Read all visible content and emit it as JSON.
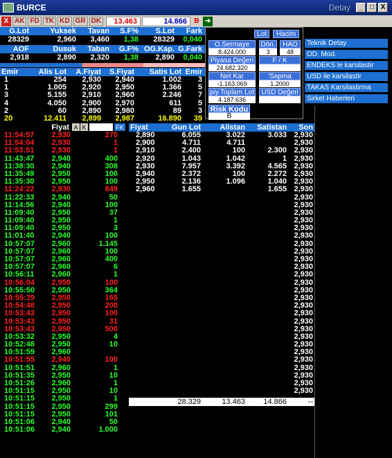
{
  "window": {
    "title": "BURCE",
    "title_right": "Detay",
    "btn_min": "_",
    "btn_max": "□",
    "btn_close": "X"
  },
  "toolbar": {
    "close": "X",
    "buttons": [
      "AK",
      "FD",
      "TK",
      "KD",
      "GR",
      "DK"
    ],
    "value1": "13.463",
    "value2": "14.866",
    "b": "B"
  },
  "summary": {
    "row1_headers": [
      "G.Lot",
      "Yuksek",
      "Tavan",
      "S.F%",
      "S.Lot",
      "Fark"
    ],
    "row1_values": [
      "28329",
      "2,960",
      "3,460",
      "1,38",
      "28329",
      "0,040"
    ],
    "row2_headers": [
      "AOF",
      "Dusuk",
      "Taban",
      "G.F%",
      "OG.Kap.",
      "G.Fark"
    ],
    "row2_values": [
      "2,918",
      "2,890",
      "2,320",
      "1,38",
      "2,890",
      "0,040"
    ]
  },
  "depth": {
    "headers": [
      "Emir",
      "Alis Lot",
      "A.Fiyat",
      "S.Fiyat",
      "Satis Lot",
      "Emir"
    ],
    "rows": [
      [
        "1",
        "254",
        "2,930",
        "2,940",
        "1.002",
        "3"
      ],
      [
        "1",
        "1.005",
        "2,920",
        "2,950",
        "1.366",
        "5"
      ],
      [
        "3",
        "5.155",
        "2,910",
        "2,960",
        "2.246",
        "7"
      ],
      [
        "4",
        "4.050",
        "2,900",
        "2,970",
        "611",
        "5"
      ],
      [
        "2",
        "60",
        "2,890",
        "2,980",
        "89",
        "3"
      ],
      [
        "20",
        "12.411",
        "2,899",
        "2,987",
        "16.890",
        "39"
      ]
    ]
  },
  "info": {
    "lot": "Lot",
    "hacim": "Hacim",
    "osermaye_label": "O.Sermaye",
    "osermaye": "8.424.000",
    "don_label": "Dön.",
    "don": "3",
    "hao_label": "HAO",
    "hao": "48",
    "piyasa_label": "Piyasa Değeri",
    "piyasa": "24.682.320",
    "fk_label": "F / K",
    "fk": "",
    "netkar_label": "Net Kar",
    "netkar": "-1.163.069",
    "sapma_label": "'Sapma",
    "sapma": "1.2000",
    "pytoplam_label": "piy.Toplam Lot",
    "pytoplam": "4.187.636",
    "usd_label": "USD Değeri",
    "usd": "",
    "risk_label": "Risk Kodu",
    "risk": "B"
  },
  "menu": [
    "Teknik Detay",
    "OD. Mod.",
    "ENDEKS le karsilastir",
    "USD ile karsilastir",
    "TAKAS Karsilastirma",
    "Sirket Haberleri"
  ],
  "trades_header": {
    "fiyat": "Fiyat",
    "a": "A",
    "k": "K",
    "fk": "FK"
  },
  "trades": [
    [
      "11:54:57",
      "2,930",
      "270",
      "r"
    ],
    [
      "11:54:04",
      "2,930",
      "1",
      "r"
    ],
    [
      "11:53:51",
      "2,930",
      "1",
      "r"
    ],
    [
      "11:43:47",
      "2,940",
      "400",
      "g"
    ],
    [
      "11:38:30",
      "2,940",
      "308",
      "g"
    ],
    [
      "11:35:49",
      "2,950",
      "100",
      "g"
    ],
    [
      "11:35:30",
      "2,950",
      "100",
      "g"
    ],
    [
      "11:24:22",
      "2,930",
      "849",
      "r"
    ],
    [
      "11:22:33",
      "2,940",
      "50",
      "g"
    ],
    [
      "11:14:56",
      "2,940",
      "100",
      "g"
    ],
    [
      "11:09:40",
      "2,950",
      "37",
      "g"
    ],
    [
      "11:09:40",
      "2,950",
      "1",
      "g"
    ],
    [
      "11:09:40",
      "2,950",
      "3",
      "g"
    ],
    [
      "11:01:40",
      "2,940",
      "100",
      "g"
    ],
    [
      "10:57:07",
      "2,960",
      "1.145",
      "g"
    ],
    [
      "10:57:07",
      "2,960",
      "100",
      "g"
    ],
    [
      "10:57:07",
      "2,960",
      "400",
      "g"
    ],
    [
      "10:57:07",
      "2,960",
      "6",
      "g"
    ],
    [
      "10:56:11",
      "2,960",
      "1",
      "g"
    ],
    [
      "10:56:04",
      "2,950",
      "100",
      "r"
    ],
    [
      "10:55:50",
      "2,950",
      "364",
      "g"
    ],
    [
      "10:55:39",
      "2,950",
      "165",
      "r"
    ],
    [
      "10:54:48",
      "2,950",
      "200",
      "r"
    ],
    [
      "10:53:43",
      "2,950",
      "100",
      "r"
    ],
    [
      "10:53:43",
      "2,950",
      "31",
      "r"
    ],
    [
      "10:53:43",
      "2,950",
      "500",
      "r"
    ],
    [
      "10:53:32",
      "2,950",
      "4",
      "g"
    ],
    [
      "10:52:48",
      "2,950",
      "10",
      "g"
    ],
    [
      "10:51:59",
      "2,960",
      "",
      "g"
    ],
    [
      "10:51:55",
      "2,940",
      "100",
      "r"
    ],
    [
      "10:51:51",
      "2,960",
      "1",
      "g"
    ],
    [
      "10:51:35",
      "2,950",
      "10",
      "g"
    ],
    [
      "10:51:26",
      "2,960",
      "1",
      "g"
    ],
    [
      "10:51:15",
      "2,950",
      "10",
      "g"
    ],
    [
      "10:51:15",
      "2,950",
      "1",
      "g"
    ],
    [
      "10:51:15",
      "2,950",
      "299",
      "g"
    ],
    [
      "10:51:15",
      "2,950",
      "101",
      "g"
    ],
    [
      "10:51:06",
      "2,940",
      "50",
      "g"
    ],
    [
      "10:51:06",
      "2,940",
      "1.000",
      "g"
    ]
  ],
  "price_hdr": [
    "Fiyat",
    "Gun Lot",
    "Alistan",
    "Satistan",
    "Son"
  ],
  "price_rows": [
    [
      "2,890",
      "6.055",
      "3.022",
      "3.033",
      "2,930"
    ],
    [
      "2,900",
      "4.711",
      "4.711",
      "",
      "2,930"
    ],
    [
      "2,910",
      "2.400",
      "100",
      "2.300",
      "2,930"
    ],
    [
      "2,920",
      "1.043",
      "1.042",
      "1",
      "2,930"
    ],
    [
      "2,930",
      "7.957",
      "3.392",
      "4.565",
      "2,930"
    ],
    [
      "2,940",
      "2.372",
      "100",
      "2.272",
      "2,930"
    ],
    [
      "2,950",
      "2.136",
      "1.096",
      "1.040",
      "2,930"
    ],
    [
      "2,960",
      "1.655",
      "",
      "1.655",
      "2,930"
    ]
  ],
  "son_col": "2,930",
  "price_total": [
    "",
    "28.329",
    "13.463",
    "14.866",
    "--"
  ],
  "colors": {
    "red": "#ff2020",
    "green": "#2cff2c",
    "yellow": "#ffff00",
    "blue": "#1d6fd1"
  }
}
